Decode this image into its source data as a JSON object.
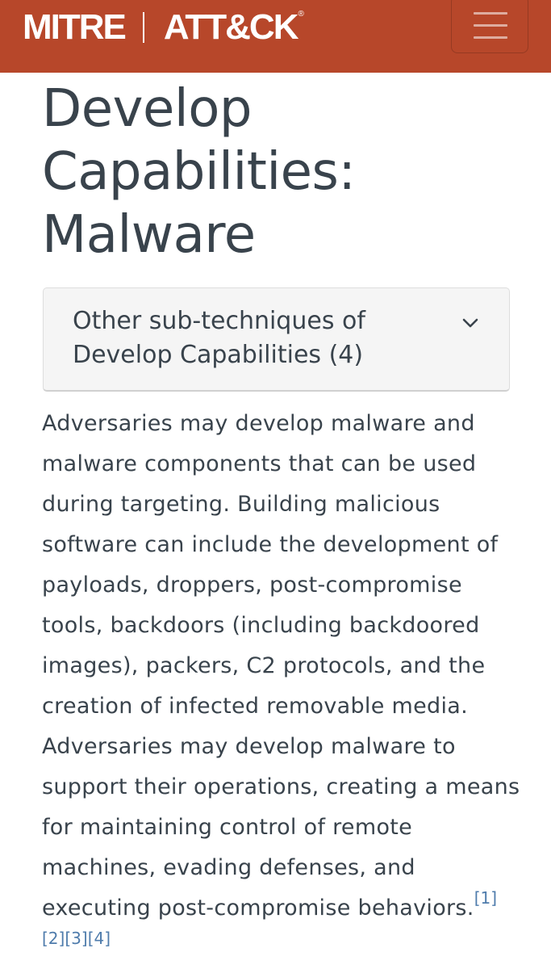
{
  "navbar": {
    "brand_left": "MITRE",
    "brand_right": "ATT&CK",
    "brand_reg": "®",
    "menu_icon": "hamburger-menu-icon",
    "background_color": "#b7472a"
  },
  "page": {
    "title_line1": "Develop",
    "title_line2": "Capabilities:",
    "title_line3": "Malware"
  },
  "subtechniques": {
    "label_line1": "Other sub-techniques of",
    "label_line2": "Develop Capabilities (4)",
    "toggle_icon": "chevron-down-icon"
  },
  "description": {
    "text": "Adversaries may develop malware and malware components that can be used during targeting. Building malicious software can include the development of payloads, droppers, post-compromise tools, backdoors (including backdoored images), packers, C2 protocols, and the creation of infected removable media. Adversaries may develop malware to support their operations, creating a means for maintaining control of remote machines, evading defenses, and executing post-compromise behaviors.",
    "references": [
      "[1]",
      "[2]",
      "[3]",
      "[4]"
    ],
    "link_color": "#4f7cac"
  }
}
